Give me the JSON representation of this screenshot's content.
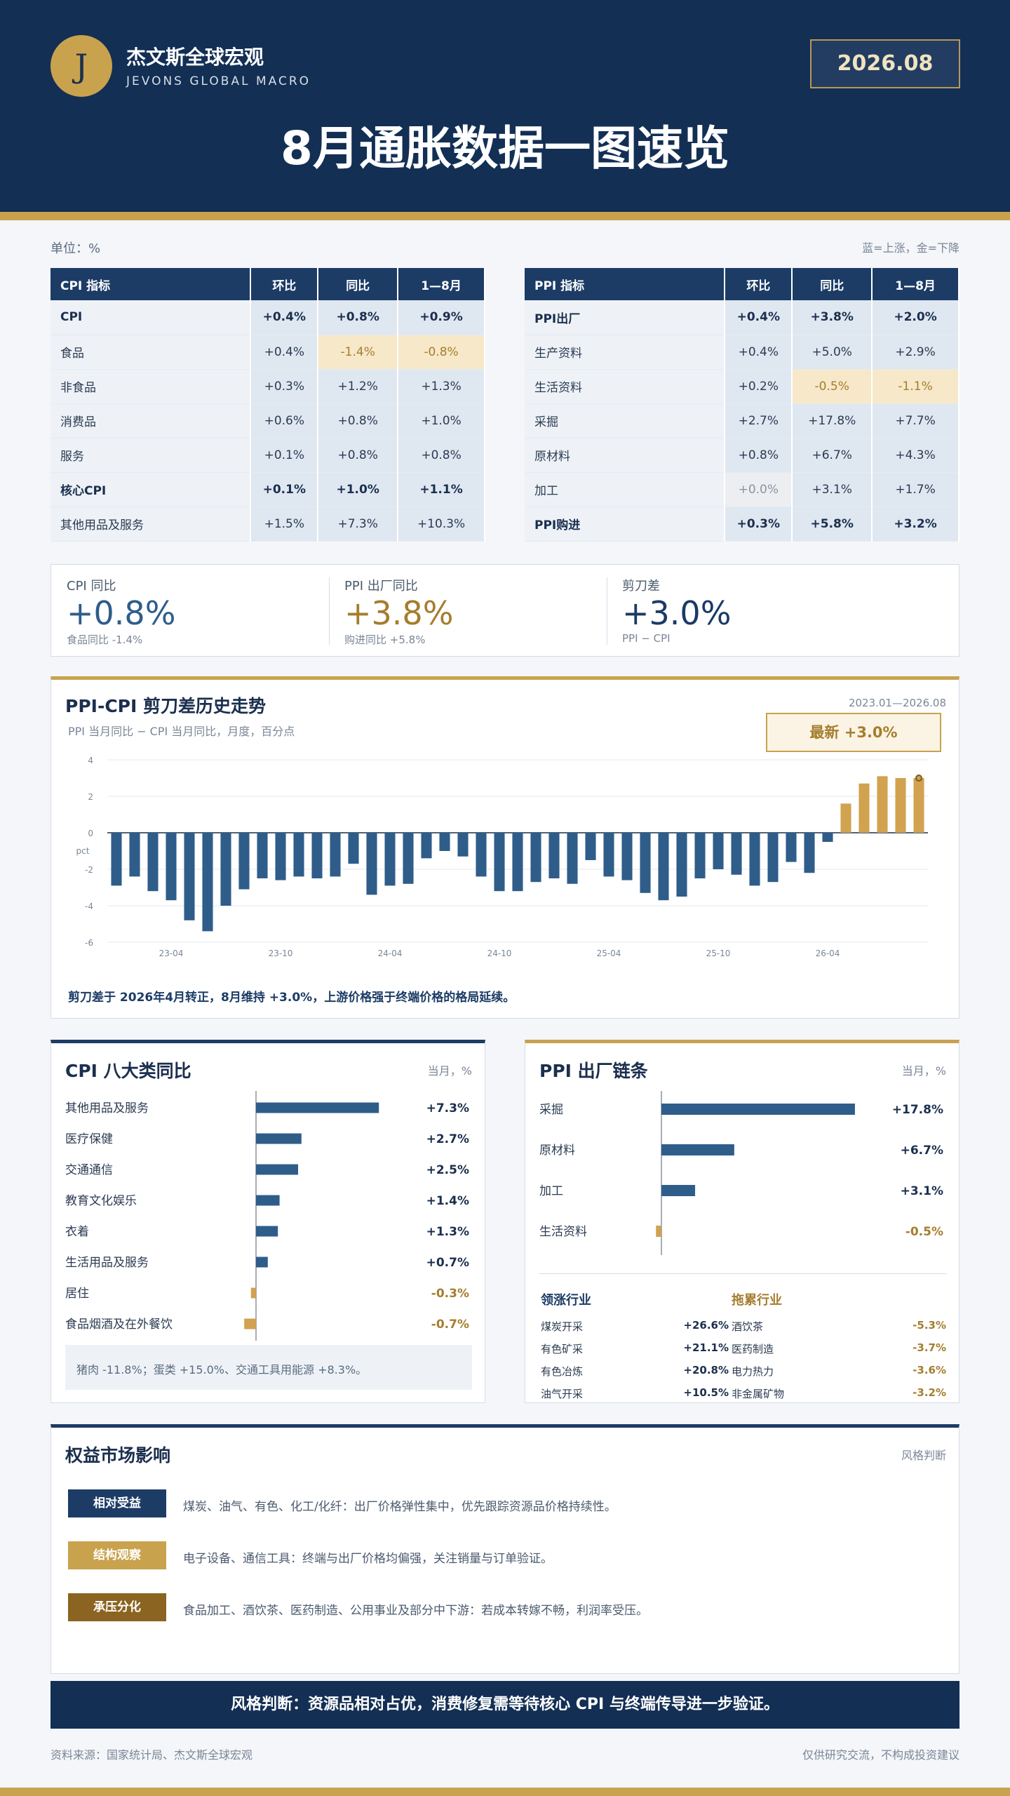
{
  "header": {
    "logo_letter": "J",
    "brand_cn": "杰文斯全球宏观",
    "brand_en": "JEVONS GLOBAL MACRO",
    "date": "2026.08",
    "title": "8月通胀数据一图速览"
  },
  "unit_label": "单位：%",
  "legend_note": "蓝=上涨，金=下降",
  "cpi_table": {
    "headers": [
      "CPI 指标",
      "环比",
      "同比",
      "1—8月"
    ],
    "rows": [
      {
        "name": "CPI",
        "mom": "+0.4%",
        "yoy": "+0.8%",
        "ytd": "+0.9%",
        "bold": true
      },
      {
        "name": "食品",
        "mom": "+0.4%",
        "yoy": "-1.4%",
        "ytd": "-0.8%"
      },
      {
        "name": "非食品",
        "mom": "+0.3%",
        "yoy": "+1.2%",
        "ytd": "+1.3%"
      },
      {
        "name": "消费品",
        "mom": "+0.6%",
        "yoy": "+0.8%",
        "ytd": "+1.0%"
      },
      {
        "name": "服务",
        "mom": "+0.1%",
        "yoy": "+0.8%",
        "ytd": "+0.8%"
      },
      {
        "name": "核心CPI",
        "mom": "+0.1%",
        "yoy": "+1.0%",
        "ytd": "+1.1%",
        "bold": true
      },
      {
        "name": "其他用品及服务",
        "mom": "+1.5%",
        "yoy": "+7.3%",
        "ytd": "+10.3%"
      }
    ]
  },
  "ppi_table": {
    "headers": [
      "PPI 指标",
      "环比",
      "同比",
      "1—8月"
    ],
    "rows": [
      {
        "name": "PPI出厂",
        "mom": "+0.4%",
        "yoy": "+3.8%",
        "ytd": "+2.0%",
        "bold": true
      },
      {
        "name": "生产资料",
        "mom": "+0.4%",
        "yoy": "+5.0%",
        "ytd": "+2.9%"
      },
      {
        "name": "生活资料",
        "mom": "+0.2%",
        "yoy": "-0.5%",
        "ytd": "-1.1%"
      },
      {
        "name": "采掘",
        "mom": "+2.7%",
        "yoy": "+17.8%",
        "ytd": "+7.7%"
      },
      {
        "name": "原材料",
        "mom": "+0.8%",
        "yoy": "+6.7%",
        "ytd": "+4.3%"
      },
      {
        "name": "加工",
        "mom": "+0.0%",
        "yoy": "+3.1%",
        "ytd": "+1.7%"
      },
      {
        "name": "PPI购进",
        "mom": "+0.3%",
        "yoy": "+5.8%",
        "ytd": "+3.2%",
        "bold": true
      }
    ]
  },
  "kpis": [
    {
      "label": "CPI 同比",
      "value": "+0.8%",
      "sub": "食品同比 -1.4%",
      "color": "#2f5d8a"
    },
    {
      "label": "PPI 出厂同比",
      "value": "+3.8%",
      "sub": "购进同比 +5.8%",
      "color": "#a57d2e"
    },
    {
      "label": "剪刀差",
      "value": "+3.0%",
      "sub": "PPI − CPI",
      "color": "#1b3a66"
    }
  ],
  "scissors": {
    "title": "PPI-CPI 剪刀差历史走势",
    "subtitle": "PPI 当月同比 − CPI 当月同比，月度，百分点",
    "range": "2023.01—2026.08",
    "latest": "最新 +3.0%",
    "note": "剪刀差于 2026年4月转正，8月维持 +3.0%，上游价格强于终端价格的格局延续。"
  },
  "chart_data": [
    {
      "type": "bar",
      "title": "PPI-CPI 剪刀差历史走势",
      "ylabel": "pct",
      "ylim": [
        -6,
        4
      ],
      "yticks": [
        4,
        2,
        0,
        -2,
        -4,
        -6
      ],
      "xtick_labels": [
        {
          "label": "23-04",
          "index": 3
        },
        {
          "label": "23-10",
          "index": 9
        },
        {
          "label": "24-04",
          "index": 15
        },
        {
          "label": "24-10",
          "index": 21
        },
        {
          "label": "25-04",
          "index": 27
        },
        {
          "label": "25-10",
          "index": 33
        },
        {
          "label": "26-04",
          "index": 39
        }
      ],
      "positive_color": "#d1a24f",
      "negative_color": "#2f5d8a",
      "values": [
        -2.9,
        -2.4,
        -3.2,
        -3.7,
        -4.8,
        -5.4,
        -4.0,
        -3.1,
        -2.5,
        -2.6,
        -2.4,
        -2.5,
        -2.4,
        -1.7,
        -3.4,
        -2.9,
        -2.8,
        -1.4,
        -1.0,
        -1.3,
        -2.4,
        -3.2,
        -3.2,
        -2.7,
        -2.5,
        -2.8,
        -1.5,
        -2.4,
        -2.6,
        -3.3,
        -3.7,
        -3.5,
        -2.5,
        -2.0,
        -2.3,
        -2.9,
        -2.7,
        -1.6,
        -2.2,
        -0.5,
        1.6,
        2.7,
        3.1,
        3.0,
        3.0
      ]
    },
    {
      "type": "bar",
      "orientation": "horizontal",
      "title": "CPI 八大类同比",
      "categories": [
        "其他用品及服务",
        "医疗保健",
        "交通通信",
        "教育文化娱乐",
        "衣着",
        "生活用品及服务",
        "居住",
        "食品烟酒及在外餐饮"
      ],
      "values": [
        7.3,
        2.7,
        2.5,
        1.4,
        1.3,
        0.7,
        -0.3,
        -0.7
      ],
      "labels": [
        "+7.3%",
        "+2.7%",
        "+2.5%",
        "+1.4%",
        "+1.3%",
        "+0.7%",
        "-0.3%",
        "-0.7%"
      ]
    },
    {
      "type": "bar",
      "orientation": "horizontal",
      "title": "PPI 出厂链条",
      "categories": [
        "采掘",
        "原材料",
        "加工",
        "生活资料"
      ],
      "values": [
        17.8,
        6.7,
        3.1,
        -0.5
      ],
      "labels": [
        "+17.8%",
        "+6.7%",
        "+3.1%",
        "-0.5%"
      ]
    }
  ],
  "cpi_panel": {
    "title": "CPI 八大类同比",
    "sub": "当月，%",
    "note": "猪肉 -11.8%；蛋类 +15.0%、交通工具用能源 +8.3%。"
  },
  "ppi_panel": {
    "title": "PPI 出厂链条",
    "sub": "当月，%",
    "leading_title": "领涨行业",
    "lagging_title": "拖累行业",
    "leading": [
      {
        "name": "煤炭开采",
        "value": "+26.6%"
      },
      {
        "name": "有色矿采",
        "value": "+21.1%"
      },
      {
        "name": "有色冶炼",
        "value": "+20.8%"
      },
      {
        "name": "油气开采",
        "value": "+10.5%"
      }
    ],
    "lagging": [
      {
        "name": "酒饮茶",
        "value": "-5.3%"
      },
      {
        "name": "医药制造",
        "value": "-3.7%"
      },
      {
        "name": "电力热力",
        "value": "-3.6%"
      },
      {
        "name": "非金属矿物",
        "value": "-3.2%"
      }
    ]
  },
  "equity": {
    "title": "权益市场影响",
    "sub": "风格判断",
    "items": [
      {
        "tag": "相对受益",
        "text": "煤炭、油气、有色、化工/化纤：出厂价格弹性集中，优先跟踪资源品价格持续性。",
        "color": "#1c3c66"
      },
      {
        "tag": "结构观察",
        "text": "电子设备、通信工具：终端与出厂价格均偏强，关注销量与订单验证。",
        "color": "#c9a24e"
      },
      {
        "tag": "承压分化",
        "text": "食品加工、酒饮茶、医药制造、公用事业及部分中下游：若成本转嫁不畅，利润率受压。",
        "color": "#8a6420"
      }
    ]
  },
  "footer": {
    "banner": "风格判断：资源品相对占优，消费修复需等待核心 CPI 与终端传导进一步验证。",
    "source": "资料来源：国家统计局、杰文斯全球宏观",
    "disclaimer": "仅供研究交流，不构成投资建议"
  }
}
